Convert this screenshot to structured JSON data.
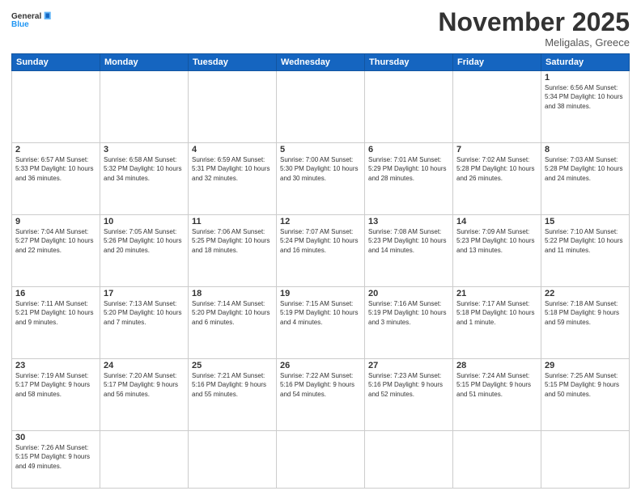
{
  "header": {
    "logo_general": "General",
    "logo_blue": "Blue",
    "month_title": "November 2025",
    "location": "Meligalas, Greece"
  },
  "weekdays": [
    "Sunday",
    "Monday",
    "Tuesday",
    "Wednesday",
    "Thursday",
    "Friday",
    "Saturday"
  ],
  "weeks": [
    [
      {
        "day": "",
        "info": ""
      },
      {
        "day": "",
        "info": ""
      },
      {
        "day": "",
        "info": ""
      },
      {
        "day": "",
        "info": ""
      },
      {
        "day": "",
        "info": ""
      },
      {
        "day": "",
        "info": ""
      },
      {
        "day": "1",
        "info": "Sunrise: 6:56 AM\nSunset: 5:34 PM\nDaylight: 10 hours\nand 38 minutes."
      }
    ],
    [
      {
        "day": "2",
        "info": "Sunrise: 6:57 AM\nSunset: 5:33 PM\nDaylight: 10 hours\nand 36 minutes."
      },
      {
        "day": "3",
        "info": "Sunrise: 6:58 AM\nSunset: 5:32 PM\nDaylight: 10 hours\nand 34 minutes."
      },
      {
        "day": "4",
        "info": "Sunrise: 6:59 AM\nSunset: 5:31 PM\nDaylight: 10 hours\nand 32 minutes."
      },
      {
        "day": "5",
        "info": "Sunrise: 7:00 AM\nSunset: 5:30 PM\nDaylight: 10 hours\nand 30 minutes."
      },
      {
        "day": "6",
        "info": "Sunrise: 7:01 AM\nSunset: 5:29 PM\nDaylight: 10 hours\nand 28 minutes."
      },
      {
        "day": "7",
        "info": "Sunrise: 7:02 AM\nSunset: 5:28 PM\nDaylight: 10 hours\nand 26 minutes."
      },
      {
        "day": "8",
        "info": "Sunrise: 7:03 AM\nSunset: 5:28 PM\nDaylight: 10 hours\nand 24 minutes."
      }
    ],
    [
      {
        "day": "9",
        "info": "Sunrise: 7:04 AM\nSunset: 5:27 PM\nDaylight: 10 hours\nand 22 minutes."
      },
      {
        "day": "10",
        "info": "Sunrise: 7:05 AM\nSunset: 5:26 PM\nDaylight: 10 hours\nand 20 minutes."
      },
      {
        "day": "11",
        "info": "Sunrise: 7:06 AM\nSunset: 5:25 PM\nDaylight: 10 hours\nand 18 minutes."
      },
      {
        "day": "12",
        "info": "Sunrise: 7:07 AM\nSunset: 5:24 PM\nDaylight: 10 hours\nand 16 minutes."
      },
      {
        "day": "13",
        "info": "Sunrise: 7:08 AM\nSunset: 5:23 PM\nDaylight: 10 hours\nand 14 minutes."
      },
      {
        "day": "14",
        "info": "Sunrise: 7:09 AM\nSunset: 5:23 PM\nDaylight: 10 hours\nand 13 minutes."
      },
      {
        "day": "15",
        "info": "Sunrise: 7:10 AM\nSunset: 5:22 PM\nDaylight: 10 hours\nand 11 minutes."
      }
    ],
    [
      {
        "day": "16",
        "info": "Sunrise: 7:11 AM\nSunset: 5:21 PM\nDaylight: 10 hours\nand 9 minutes."
      },
      {
        "day": "17",
        "info": "Sunrise: 7:13 AM\nSunset: 5:20 PM\nDaylight: 10 hours\nand 7 minutes."
      },
      {
        "day": "18",
        "info": "Sunrise: 7:14 AM\nSunset: 5:20 PM\nDaylight: 10 hours\nand 6 minutes."
      },
      {
        "day": "19",
        "info": "Sunrise: 7:15 AM\nSunset: 5:19 PM\nDaylight: 10 hours\nand 4 minutes."
      },
      {
        "day": "20",
        "info": "Sunrise: 7:16 AM\nSunset: 5:19 PM\nDaylight: 10 hours\nand 3 minutes."
      },
      {
        "day": "21",
        "info": "Sunrise: 7:17 AM\nSunset: 5:18 PM\nDaylight: 10 hours\nand 1 minute."
      },
      {
        "day": "22",
        "info": "Sunrise: 7:18 AM\nSunset: 5:18 PM\nDaylight: 9 hours\nand 59 minutes."
      }
    ],
    [
      {
        "day": "23",
        "info": "Sunrise: 7:19 AM\nSunset: 5:17 PM\nDaylight: 9 hours\nand 58 minutes."
      },
      {
        "day": "24",
        "info": "Sunrise: 7:20 AM\nSunset: 5:17 PM\nDaylight: 9 hours\nand 56 minutes."
      },
      {
        "day": "25",
        "info": "Sunrise: 7:21 AM\nSunset: 5:16 PM\nDaylight: 9 hours\nand 55 minutes."
      },
      {
        "day": "26",
        "info": "Sunrise: 7:22 AM\nSunset: 5:16 PM\nDaylight: 9 hours\nand 54 minutes."
      },
      {
        "day": "27",
        "info": "Sunrise: 7:23 AM\nSunset: 5:16 PM\nDaylight: 9 hours\nand 52 minutes."
      },
      {
        "day": "28",
        "info": "Sunrise: 7:24 AM\nSunset: 5:15 PM\nDaylight: 9 hours\nand 51 minutes."
      },
      {
        "day": "29",
        "info": "Sunrise: 7:25 AM\nSunset: 5:15 PM\nDaylight: 9 hours\nand 50 minutes."
      }
    ],
    [
      {
        "day": "30",
        "info": "Sunrise: 7:26 AM\nSunset: 5:15 PM\nDaylight: 9 hours\nand 49 minutes."
      },
      {
        "day": "",
        "info": ""
      },
      {
        "day": "",
        "info": ""
      },
      {
        "day": "",
        "info": ""
      },
      {
        "day": "",
        "info": ""
      },
      {
        "day": "",
        "info": ""
      },
      {
        "day": "",
        "info": ""
      }
    ]
  ]
}
